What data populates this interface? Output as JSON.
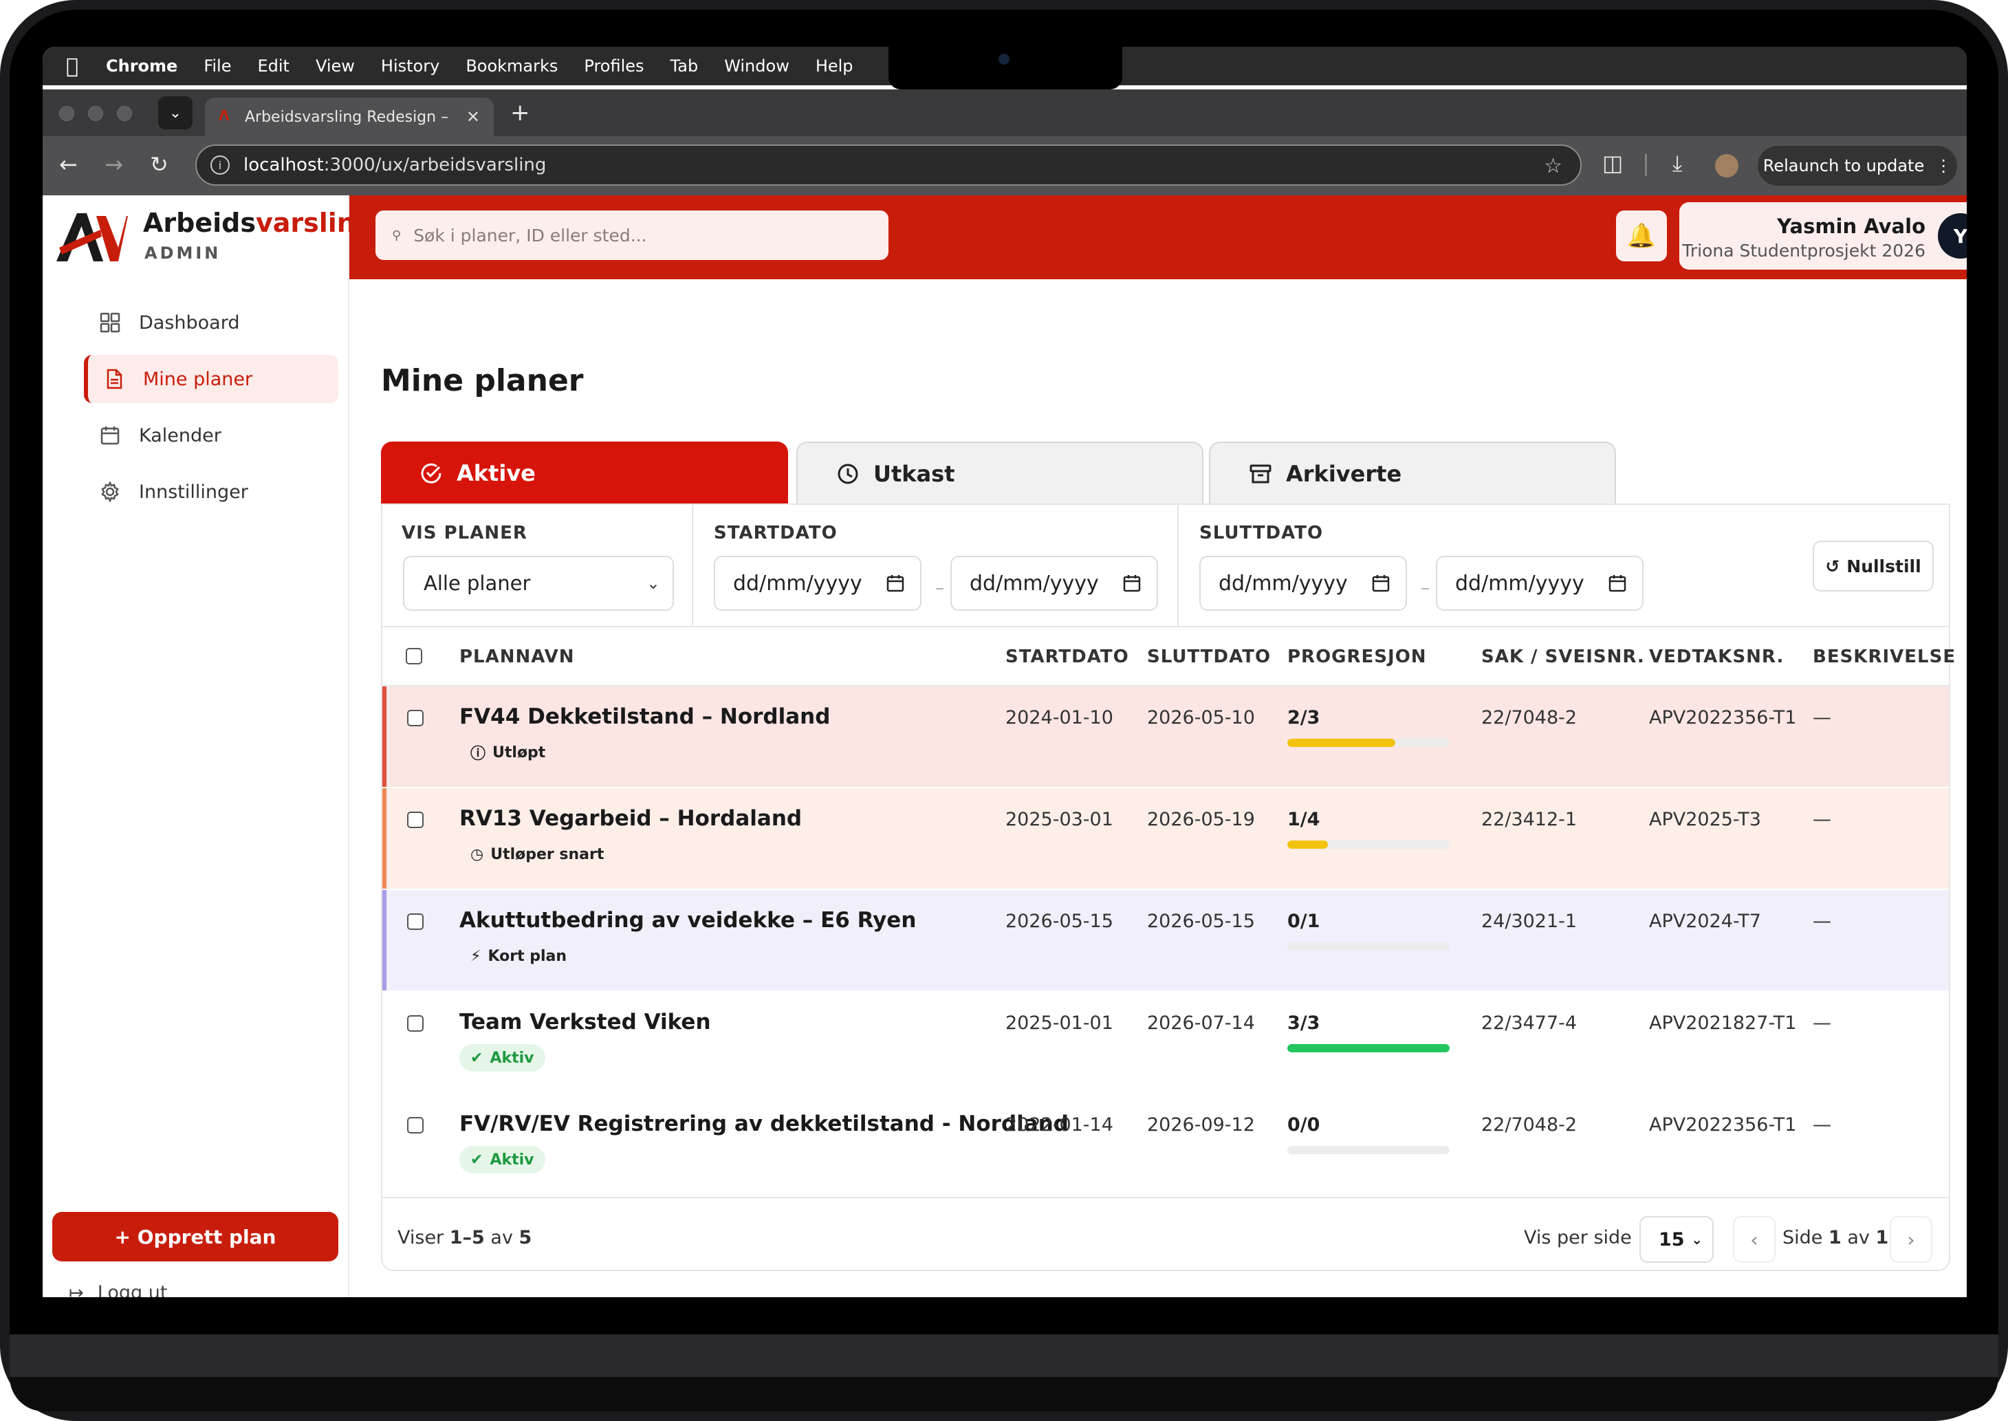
{
  "menubar": {
    "app": "Chrome",
    "items": [
      "File",
      "Edit",
      "View",
      "History",
      "Bookmarks",
      "Profiles",
      "Tab",
      "Window",
      "Help"
    ]
  },
  "browser": {
    "tab_title": "Arbeidsvarsling Redesign –",
    "url_host": "localhost",
    "url_path": ":3000/ux/arbeidsvarsling",
    "relaunch_label": "Relaunch to update"
  },
  "brand": {
    "name_dark": "Arbeids",
    "name_red": "varsling",
    "sub": "ADMIN",
    "accent": "#c81d0b"
  },
  "sidebar": {
    "items": [
      {
        "label": "Dashboard",
        "icon": "grid-icon"
      },
      {
        "label": "Mine planer",
        "icon": "document-icon"
      },
      {
        "label": "Kalender",
        "icon": "calendar-icon"
      },
      {
        "label": "Innstillinger",
        "icon": "gear-icon"
      }
    ],
    "create_label": "+ Opprett plan",
    "logout_label": "Logg ut"
  },
  "topbar": {
    "search_placeholder": "Søk i planer, ID eller sted...",
    "user_name": "Yasmin Avalo",
    "user_org": "Triona Studentprosjekt 2026",
    "avatar_initial": "Y"
  },
  "main": {
    "title": "Mine planer",
    "tabs": [
      {
        "label": "Aktive",
        "icon": "check-circle-icon"
      },
      {
        "label": "Utkast",
        "icon": "clock-icon"
      },
      {
        "label": "Arkiverte",
        "icon": "archive-icon"
      }
    ],
    "filters": {
      "vis_label": "VIS PLANER",
      "vis_value": "Alle planer",
      "start_label": "STARTDATO",
      "end_label": "SLUTTDATO",
      "date_placeholder": "dd/mm/yyyy",
      "reset_label": "Nullstill"
    },
    "columns": [
      "PLANNAVN",
      "STARTDATO",
      "SLUTTDATO",
      "PROGRESJON",
      "SAK / SVEISNR.",
      "VEDTAKSNR.",
      "BESKRIVELSE"
    ],
    "rows": [
      {
        "name": "FV44 Dekketilstand – Nordland",
        "status": "Utløpt",
        "start": "2024-01-10",
        "end": "2026-05-10",
        "progress": "2/3",
        "progress_fraction": 0.667,
        "sak": "22/7048-2",
        "vedtak": "APV2022356-T1",
        "desc": "—"
      },
      {
        "name": "RV13 Vegarbeid – Hordaland",
        "status": "Utløper snart",
        "start": "2025-03-01",
        "end": "2026-05-19",
        "progress": "1/4",
        "progress_fraction": 0.25,
        "sak": "22/3412-1",
        "vedtak": "APV2025-T3",
        "desc": "—"
      },
      {
        "name": "Akuttutbedring av veidekke – E6 Ryen",
        "status": "Kort plan",
        "start": "2026-05-15",
        "end": "2026-05-15",
        "progress": "0/1",
        "progress_fraction": 0,
        "sak": "24/3021-1",
        "vedtak": "APV2024-T7",
        "desc": "—"
      },
      {
        "name": "Team Verksted Viken",
        "status": "Aktiv",
        "start": "2025-01-01",
        "end": "2026-07-14",
        "progress": "3/3",
        "progress_fraction": 1,
        "sak": "22/3477-4",
        "vedtak": "APV2021827-T1",
        "desc": "—"
      },
      {
        "name": "FV/RV/EV Registrering av dekketilstand - Nordland",
        "status": "Aktiv",
        "start": "2022-01-14",
        "end": "2026-09-12",
        "progress": "0/0",
        "progress_fraction": 0,
        "sak": "22/7048-2",
        "vedtak": "APV2022356-T1",
        "desc": "—"
      }
    ],
    "footer": {
      "showing_prefix": "Viser ",
      "showing_range": "1–5",
      "showing_mid": " av ",
      "showing_total": "5",
      "per_page_label": "Vis per side",
      "per_page_value": "15",
      "page_prefix": "Side ",
      "page_current": "1",
      "page_mid": " av ",
      "page_total": "1"
    }
  }
}
